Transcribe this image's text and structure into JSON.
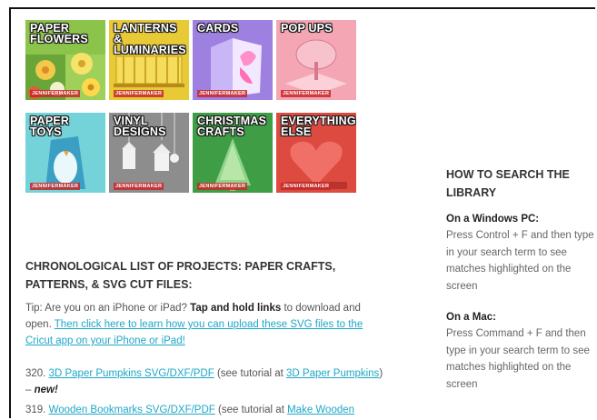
{
  "tiles": [
    {
      "label": "PAPER\nFLOWERS",
      "brand": "JENNIFERMAKER",
      "bg": "#8cc34a"
    },
    {
      "label": "LANTERNS &\nLUMINARIES",
      "brand": "JENNIFERMAKER",
      "bg": "#e6c832"
    },
    {
      "label": "CARDS",
      "brand": "JENNIFERMAKER",
      "bg": "#a98ae8"
    },
    {
      "label": "POP UPS",
      "brand": "JENNIFERMAKER",
      "bg": "#f29aa8"
    },
    {
      "label": "PAPER\nTOYS",
      "brand": "JENNIFERMAKER",
      "bg": "#6fd0d6"
    },
    {
      "label": "VINYL\nDESIGNS",
      "brand": "JENNIFERMAKER",
      "bg": "#8a8a8a"
    },
    {
      "label": "CHRISTMAS\nCRAFTS",
      "brand": "JENNIFERMAKER",
      "bg": "#4caf50"
    },
    {
      "label": "EVERYTHING\nELSE",
      "brand": "JENNIFERMAKER",
      "bg": "#e0463c"
    }
  ],
  "main": {
    "section_title": "CHRONOLOGICAL LIST OF PROJECTS: PAPER CRAFTS, PATTERNS, & SVG CUT FILES:",
    "tip_prefix": "Tip: Are you on an iPhone or iPad?",
    "tip_bold": "Tap and hold links",
    "tip_middle": "to download and open.",
    "tip_link": "Then click here to learn how you can upload these SVG files to the Cricut app on your iPhone or iPad!",
    "entries": [
      {
        "number": "320.",
        "link1": "3D Paper Pumpkins SVG/DXF/PDF",
        "see": "(see tutorial at",
        "link2": "3D Paper Pumpkins",
        "after": ") –",
        "badge": "new!"
      },
      {
        "number": "319.",
        "link1": "Wooden Bookmarks SVG/DXF/PDF",
        "see": "(see tutorial at",
        "link2": "Make Wooden",
        "after": "",
        "badge": ""
      }
    ]
  },
  "sidebar": {
    "title": "HOW TO SEARCH THE LIBRARY",
    "sections": [
      {
        "heading": "On a Windows PC:",
        "text": "Press Control + F and then type in your search term to see matches highlighted on the screen"
      },
      {
        "heading": "On a Mac:",
        "text": "Press Command + F and then type in your search term to see matches highlighted on the screen"
      }
    ]
  }
}
